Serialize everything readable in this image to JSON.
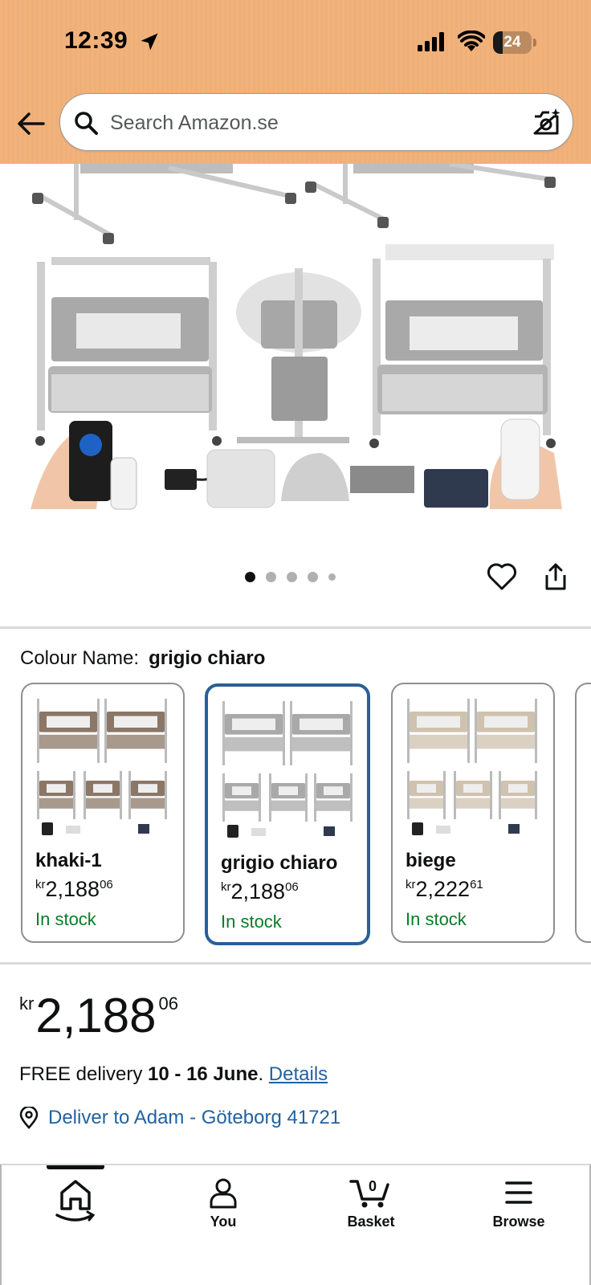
{
  "status_bar": {
    "time": "12:39",
    "battery": "24",
    "battery_level_percent": 24
  },
  "search": {
    "placeholder": "Search Amazon.se"
  },
  "image_carousel": {
    "page_count": 5,
    "current_page": 1
  },
  "colour": {
    "label": "Colour Name:",
    "selected": "grigio chiaro"
  },
  "variants": [
    {
      "name": "khaki-1",
      "currency": "kr",
      "price_main": "2,188",
      "price_cents": "06",
      "stock": "In stock",
      "tint": "#8b7767"
    },
    {
      "name": "grigio chiaro",
      "currency": "kr",
      "price_main": "2,188",
      "price_cents": "06",
      "stock": "In stock",
      "tint": "#a9a9a9"
    },
    {
      "name": "biege",
      "currency": "kr",
      "price_main": "2,222",
      "price_cents": "61",
      "stock": "In stock",
      "tint": "#cfc2ae"
    }
  ],
  "price": {
    "currency": "kr",
    "main": "2,188",
    "cents": "06"
  },
  "delivery": {
    "prefix": "FREE delivery ",
    "dates": "10 - 16 June",
    "suffix": ". ",
    "link": "Details"
  },
  "location": {
    "text": "Deliver to Adam - Göteborg 41721"
  },
  "nav": {
    "home_label": "",
    "you_label": "You",
    "basket_label": "Basket",
    "basket_count": "0",
    "browse_label": "Browse"
  },
  "colors": {
    "header_bg": "#f2b27a",
    "link": "#2162a1",
    "stock_green": "#067d28",
    "selected_border": "#2a5f98"
  }
}
